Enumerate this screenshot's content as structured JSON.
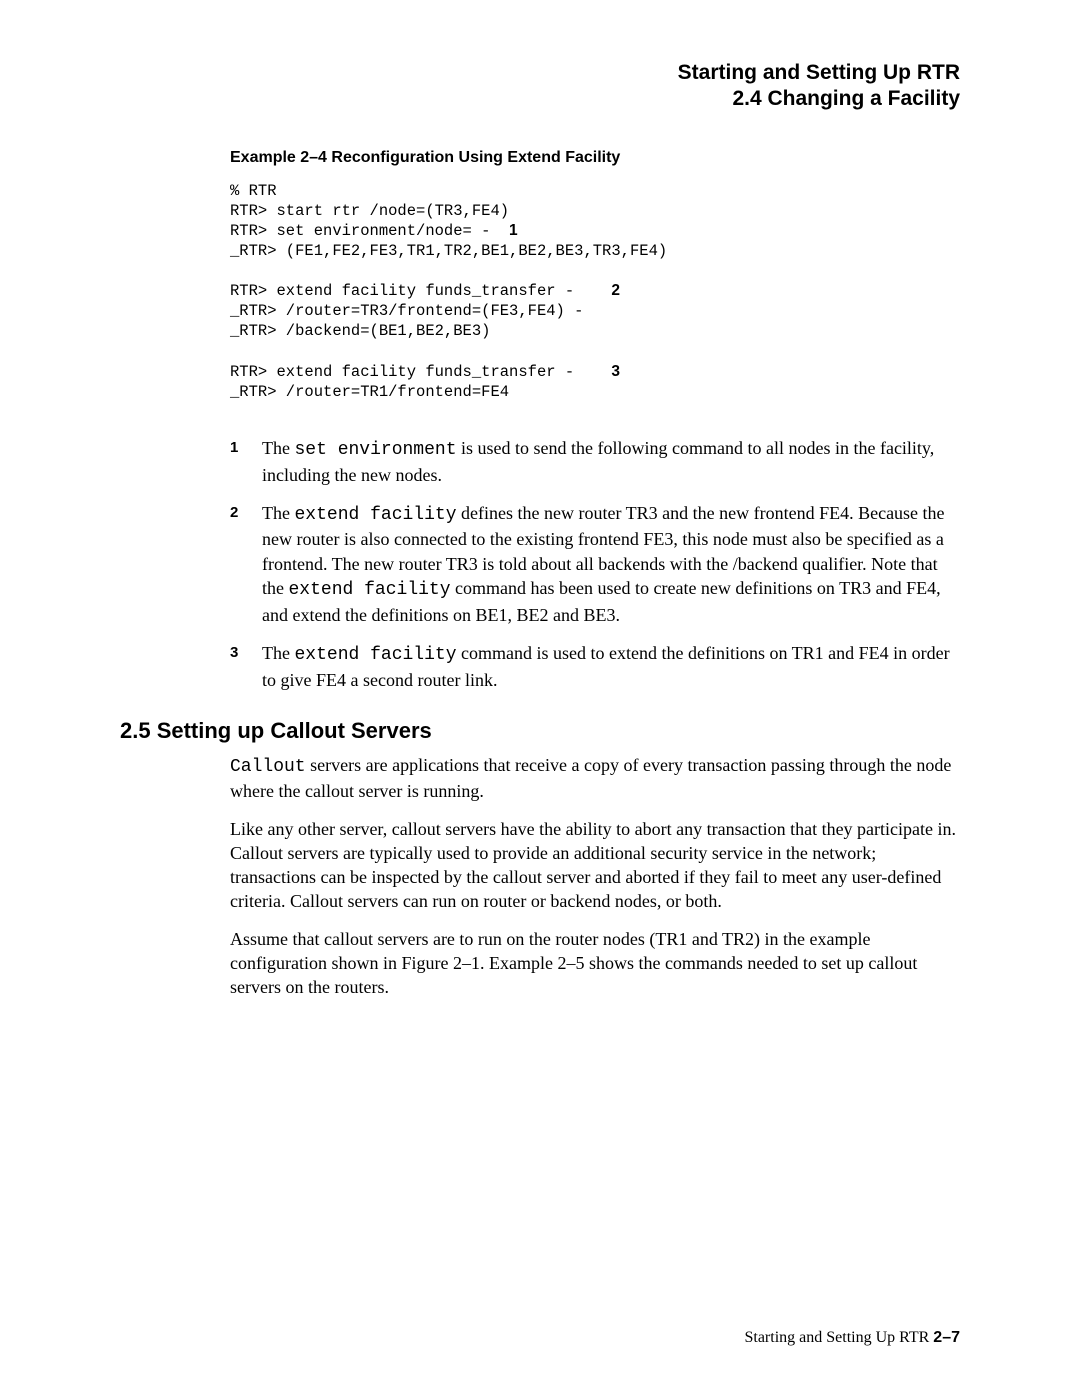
{
  "header": {
    "line1": "Starting and Setting Up RTR",
    "line2": "2.4 Changing a Facility"
  },
  "example": {
    "caption": "Example 2–4   Reconfiguration Using Extend Facility",
    "code": {
      "l1": "% RTR",
      "l2": "RTR> start rtr /node=(TR3,FE4)",
      "l3a": "RTR> set environment/node= -  ",
      "l3_callout": "1",
      "l4": "_RTR> (FE1,FE2,FE3,TR1,TR2,BE1,BE2,BE3,TR3,FE4)",
      "blank1": "",
      "l5a": "RTR> extend facility funds_transfer -    ",
      "l5_callout": "2",
      "l6": "_RTR> /router=TR3/frontend=(FE3,FE4) -",
      "l7": "_RTR> /backend=(BE1,BE2,BE3)",
      "blank2": "",
      "l8a": "RTR> extend facility funds_transfer -    ",
      "l8_callout": "3",
      "l9": "_RTR> /router=TR1/frontend=FE4"
    }
  },
  "explanations": {
    "item1": {
      "num": "1",
      "t1": "The ",
      "code1": "set environment",
      "t2": " is used to send the following command to all nodes in the facility, including the new nodes."
    },
    "item2": {
      "num": "2",
      "t1": "The ",
      "code1": "extend facility",
      "t2": " defines the new router TR3 and the new frontend FE4. Because the new router is also connected to the existing frontend FE3, this node must also be specified as a frontend. The new router TR3 is told about all backends with the /backend qualifier. Note that the ",
      "code2": "extend facility",
      "t3": " command has been used to create new definitions on TR3 and FE4, and extend the definitions on BE1, BE2 and BE3."
    },
    "item3": {
      "num": "3",
      "t1": "The ",
      "code1": "extend facility",
      "t2": " command is used to extend the definitions on TR1 and FE4 in order to give FE4 a second router link."
    }
  },
  "section": {
    "heading": "2.5  Setting up Callout Servers",
    "para1": {
      "code1": "Callout",
      "t1": " servers are applications that receive a copy of every transaction passing through the node where the callout server is running."
    },
    "para2": "Like any other server, callout servers have the ability to abort any transaction that they participate in. Callout servers are typically used to provide an additional security service in the network; transactions can be inspected by the callout server and aborted if they fail to meet any user-defined criteria. Callout servers can run on router or backend nodes, or both.",
    "para3": "Assume that callout servers are to run on the router nodes (TR1 and TR2) in the example configuration shown in Figure 2–1. Example 2–5 shows the commands needed to set up callout servers on the routers."
  },
  "footer": {
    "label": "Starting and Setting Up RTR  ",
    "page": "2–7"
  }
}
